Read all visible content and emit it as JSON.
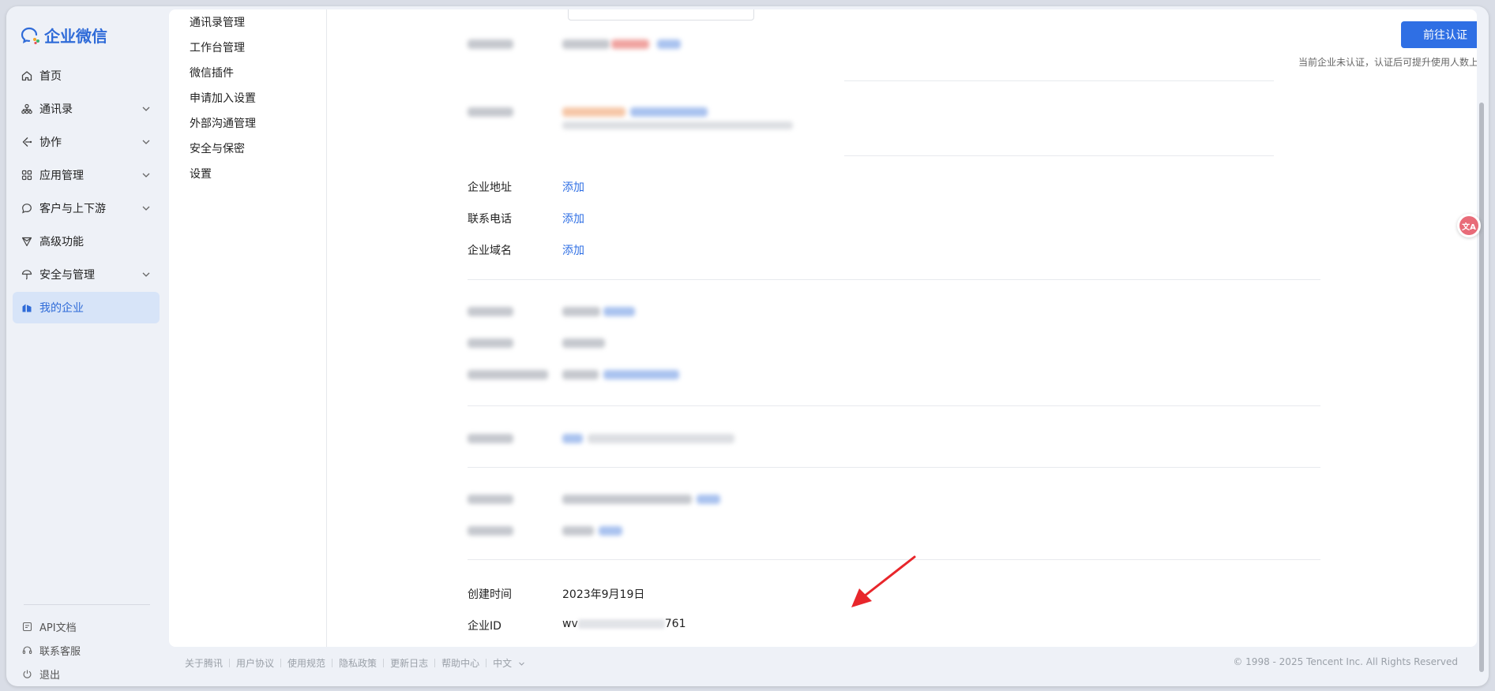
{
  "brand": {
    "name": "企业微信"
  },
  "sidebar": {
    "items": [
      {
        "label": "首页",
        "icon": "home-icon"
      },
      {
        "label": "通讯录",
        "icon": "org-icon"
      },
      {
        "label": "协作",
        "icon": "collab-icon"
      },
      {
        "label": "应用管理",
        "icon": "apps-icon"
      },
      {
        "label": "客户与上下游",
        "icon": "chat-icon"
      },
      {
        "label": "高级功能",
        "icon": "diamond-icon"
      },
      {
        "label": "安全与管理",
        "icon": "umbrella-icon"
      },
      {
        "label": "我的企业",
        "icon": "building-icon",
        "active": true
      }
    ],
    "bottom": [
      {
        "label": "API文档",
        "icon": "doc-icon"
      },
      {
        "label": "联系客服",
        "icon": "headset-icon"
      },
      {
        "label": "退出",
        "icon": "power-icon"
      }
    ]
  },
  "subnav": [
    "通讯录管理",
    "工作台管理",
    "微信插件",
    "申请加入设置",
    "外部沟通管理",
    "安全与保密",
    "设置"
  ],
  "main": {
    "cert_button": "前往认证",
    "cert_hint": "当前企业未认证，认证后可提升使用人数上限",
    "fields": [
      {
        "label": "企业地址",
        "action": "添加"
      },
      {
        "label": "联系电话",
        "action": "添加"
      },
      {
        "label": "企业域名",
        "action": "添加"
      }
    ],
    "created_label": "创建时间",
    "created_value": "2023年9月19日",
    "id_label": "企业ID",
    "id_prefix": "wv",
    "id_suffix": "761"
  },
  "footer": {
    "links": [
      "关于腾讯",
      "用户协议",
      "使用规范",
      "隐私政策",
      "更新日志",
      "帮助中心",
      "中文"
    ],
    "copyright": "© 1998 - 2025 Tencent Inc. All Rights Reserved"
  },
  "colors": {
    "accent": "#2f6fe4",
    "active_bg": "#d7e4f8",
    "annotation_arrow": "#e8262b"
  }
}
